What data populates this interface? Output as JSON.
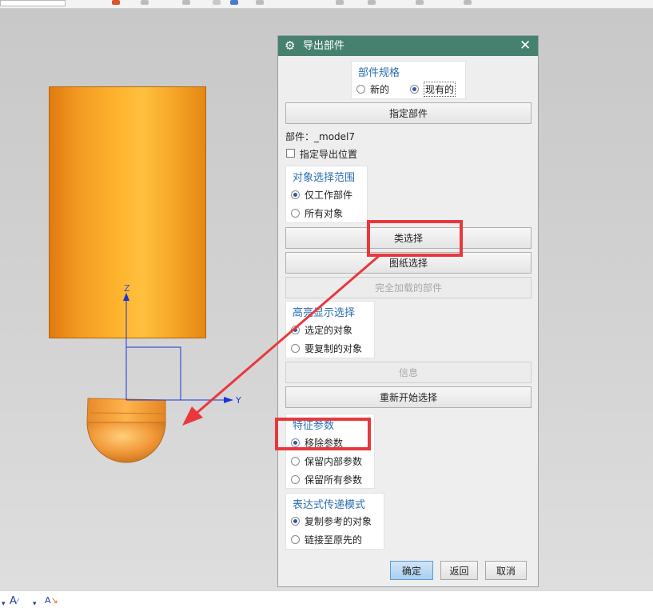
{
  "dialog": {
    "title": "导出部件",
    "part_spec": {
      "title": "部件规格",
      "options": [
        {
          "label": "新的",
          "selected": false
        },
        {
          "label": "现有的",
          "selected": true
        }
      ]
    },
    "specify_part_button": "指定部件",
    "part_info": "部件：_model7",
    "export_location_checkbox": {
      "label": "指定导出位置",
      "checked": false
    },
    "object_scope": {
      "title": "对象选择范围",
      "options": [
        {
          "label": "仅工作部件",
          "selected": true
        },
        {
          "label": "所有对象",
          "selected": false
        }
      ]
    },
    "class_selection_button": "类选择",
    "drawing_selection_button": "图纸选择",
    "fully_loaded_parts_button": "完全加载的部件",
    "highlight_selection": {
      "title": "高亮显示选择",
      "options": [
        {
          "label": "选定的对象",
          "selected": true
        },
        {
          "label": "要复制的对象",
          "selected": false
        }
      ]
    },
    "info_button": "信息",
    "restart_selection_button": "重新开始选择",
    "feature_params": {
      "title": "特征参数",
      "options": [
        {
          "label": "移除参数",
          "selected": true
        },
        {
          "label": "保留内部参数",
          "selected": false
        },
        {
          "label": "保留所有参数",
          "selected": false
        }
      ]
    },
    "expression_mode": {
      "title": "表达式传递模式",
      "options": [
        {
          "label": "复制参考的对象",
          "selected": true
        },
        {
          "label": "链接至原先的",
          "selected": false
        }
      ]
    },
    "ok_button": "确定",
    "back_button": "返回",
    "cancel_button": "取消"
  },
  "viewport": {
    "axis_z_label": "Z",
    "axis_y_label": "Y"
  },
  "colors": {
    "title_bar": "#46806f",
    "group_title": "#2a6fb0",
    "annotation_red": "#e8383d",
    "model_orange": "#f29a22",
    "axis_blue": "#1a35d6"
  },
  "icons": [
    "gear-icon",
    "close-icon",
    "text-style-icon",
    "text-format-icon"
  ]
}
